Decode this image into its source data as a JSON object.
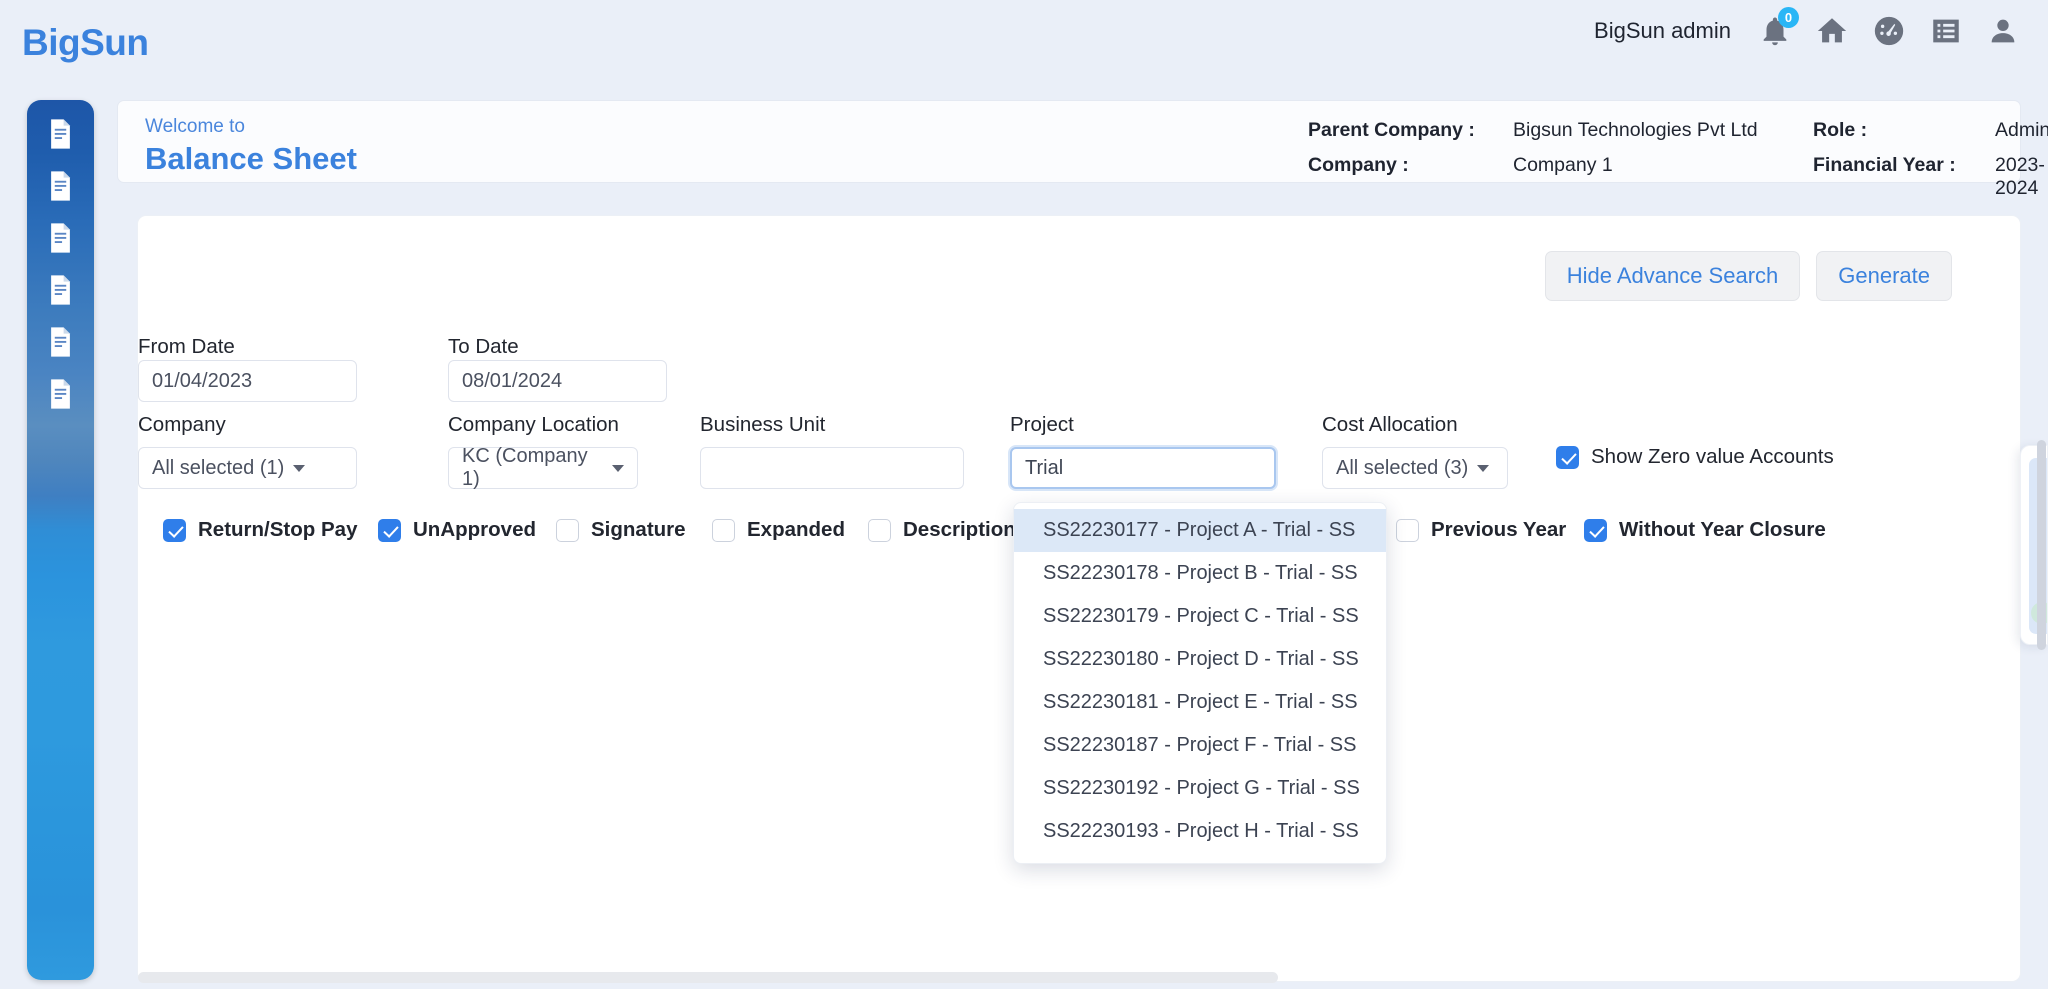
{
  "app": {
    "brand": "BigSun",
    "admin_label": "BigSun admin",
    "notification_count": "0",
    "accent_blue": "#3b82dd",
    "checkbox_blue": "#2f7eea",
    "badge_blue": "#29b6f6"
  },
  "header_icons": [
    {
      "name": "bell-icon",
      "label": "Notifications"
    },
    {
      "name": "home-icon",
      "label": "Home"
    },
    {
      "name": "dashboard-icon",
      "label": "Dashboard"
    },
    {
      "name": "list-icon",
      "label": "List"
    },
    {
      "name": "user-icon",
      "label": "Profile"
    }
  ],
  "sidebar": {
    "items": [
      {
        "icon": "document-icon",
        "label": "Report 1"
      },
      {
        "icon": "document-icon",
        "label": "Report 2"
      },
      {
        "icon": "document-icon",
        "label": "Report 3"
      },
      {
        "icon": "document-icon",
        "label": "Report 4"
      },
      {
        "icon": "document-icon",
        "label": "Report 5"
      },
      {
        "icon": "document-icon",
        "label": "Report 6"
      }
    ]
  },
  "banner": {
    "welcome_small": "Welcome to",
    "title": "Balance Sheet",
    "meta": [
      {
        "key": "Parent Company :",
        "value": "Bigsun Technologies Pvt Ltd"
      },
      {
        "key": "Role :",
        "value": "Admin"
      },
      {
        "key": "Company :",
        "value": "Company 1"
      },
      {
        "key": "Financial Year :",
        "value": "2023-2024"
      }
    ]
  },
  "toolbar": {
    "hide_advance_search": "Hide Advance Search",
    "generate": "Generate"
  },
  "filters": {
    "from_date": {
      "label": "From Date",
      "value": "01/04/2023"
    },
    "to_date": {
      "label": "To Date",
      "value": "08/01/2024"
    },
    "company": {
      "label": "Company",
      "value": "All selected (1)"
    },
    "company_location": {
      "label": "Company Location",
      "value": "KC (Company 1)"
    },
    "business_unit": {
      "label": "Business Unit",
      "value": "",
      "placeholder": ""
    },
    "project": {
      "label": "Project",
      "value": "Trial",
      "placeholder": ""
    },
    "cost_allocation": {
      "label": "Cost Allocation",
      "value": "All selected (3)"
    },
    "show_zero_value_accounts": {
      "label": "Show Zero value Accounts",
      "checked": true
    }
  },
  "project_suggestions": [
    {
      "text": "SS22230177 - Project A - Trial - SS",
      "active": true
    },
    {
      "text": "SS22230178 - Project B - Trial - SS",
      "active": false
    },
    {
      "text": "SS22230179 - Project C - Trial - SS",
      "active": false
    },
    {
      "text": "SS22230180 - Project D - Trial - SS",
      "active": false
    },
    {
      "text": "SS22230181 - Project E - Trial - SS",
      "active": false
    },
    {
      "text": "SS22230187 - Project F - Trial - SS",
      "active": false
    },
    {
      "text": "SS22230192 - Project G - Trial - SS",
      "active": false
    },
    {
      "text": "SS22230193 - Project H - Trial - SS",
      "active": false
    }
  ],
  "checkboxes": [
    {
      "label": "Return/Stop Pay",
      "checked": true
    },
    {
      "label": "UnApproved",
      "checked": true
    },
    {
      "label": "Signature",
      "checked": false
    },
    {
      "label": "Expanded",
      "checked": false
    },
    {
      "label": "Description",
      "checked": false
    },
    {
      "label": "Previous Year",
      "checked": false
    },
    {
      "label": "Without Year Closure",
      "checked": true
    }
  ]
}
